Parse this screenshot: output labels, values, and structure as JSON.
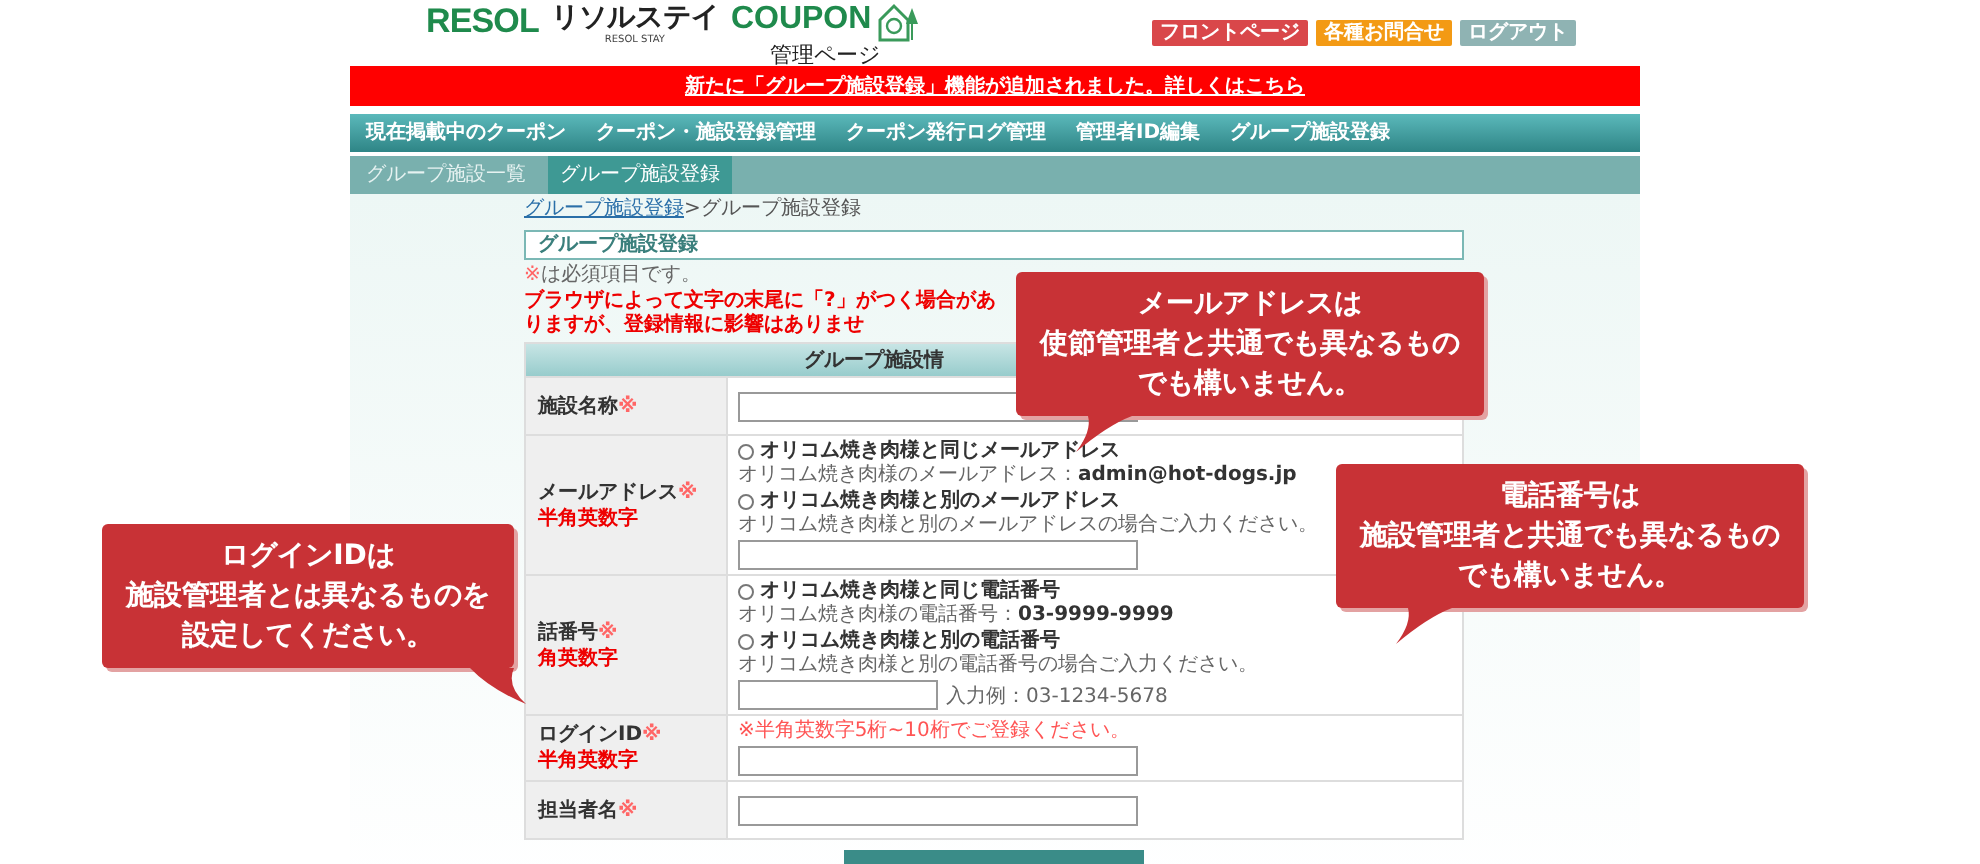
{
  "logo": {
    "resol": "RESOL",
    "stay": "リソルステイ",
    "stay_sub": "RESOL STAY",
    "coupon": "COUPON",
    "subtitle": "管理ページ"
  },
  "header_buttons": [
    {
      "label": "フロントページ",
      "color": "#d9474a"
    },
    {
      "label": "各種お問合せ",
      "color": "#f39a14"
    },
    {
      "label": "ログアウト",
      "color": "#8fb3b3"
    }
  ],
  "announcement": "新たに「グループ施設登録」機能が追加されました。詳しくはこちら",
  "nav": [
    "現在掲載中のクーポン",
    "クーポン・施設登録管理",
    "クーポン発行ログ管理",
    "管理者ID編集",
    "グループ施設登録"
  ],
  "subnav": [
    {
      "label": "グループ施設一覧",
      "selected": false
    },
    {
      "label": "グループ施設登録",
      "selected": true
    }
  ],
  "breadcrumb": {
    "link": "グループ施設登録",
    "current": ">グループ施設登録"
  },
  "section_title": "グループ施設登録",
  "required_note": {
    "mark": "※",
    "text": "は必須項目です。"
  },
  "warning": "ブラウザによって文字の末尾に「?」がつく場合がありますが、登録情報に影響はありませ",
  "form": {
    "header": "グループ施設情",
    "rows": [
      {
        "kind": "text",
        "label": "施設名称",
        "mark": "※"
      },
      {
        "kind": "choice",
        "label": "メールアドレス",
        "mark": "※",
        "sublabel": "半角英数字",
        "options": [
          {
            "label": "オリコム焼き肉様と同じメールアドレス",
            "note": "オリコム焼き肉様のメールアドレス：",
            "value": "admin@hot-dogs.jp",
            "selected": false
          },
          {
            "label": "オリコム焼き肉様と別のメールアドレス",
            "note": "オリコム焼き肉様と別のメールアドレスの場合ご入力ください。",
            "selected": false
          }
        ]
      },
      {
        "kind": "choice",
        "label": "話番号",
        "mark": "※",
        "sublabel": "角英数字",
        "options": [
          {
            "label": "オリコム焼き肉様と同じ電話番号",
            "note": "オリコム焼き肉様の電話番号：",
            "value": "03-9999-9999",
            "selected": false
          },
          {
            "label": "オリコム焼き肉様と別の電話番号",
            "note": "オリコム焼き肉様と別の電話番号の場合ご入力ください。",
            "selected": false
          }
        ],
        "example": "入力例：03-1234-5678"
      },
      {
        "kind": "notice",
        "label": "ログインID",
        "mark": "※",
        "sublabel": "半角英数字",
        "notice": "※半角英数字5桁~10桁でご登録ください。"
      },
      {
        "kind": "text",
        "label": "担当者名",
        "mark": "※"
      }
    ]
  },
  "callouts": [
    {
      "kind": "down-left",
      "lines": [
        "メールアドレスは",
        "使節管理者と共通でも異なるもの",
        "でも構いません。"
      ]
    },
    {
      "kind": "down-left",
      "lines": [
        "電話番号は",
        "施設管理者と共通でも異なるもの",
        "でも構いません。"
      ]
    },
    {
      "kind": "down-right",
      "lines": [
        "ログインIDは",
        "施設管理者とは異なるものを",
        "設定してください。"
      ]
    }
  ]
}
